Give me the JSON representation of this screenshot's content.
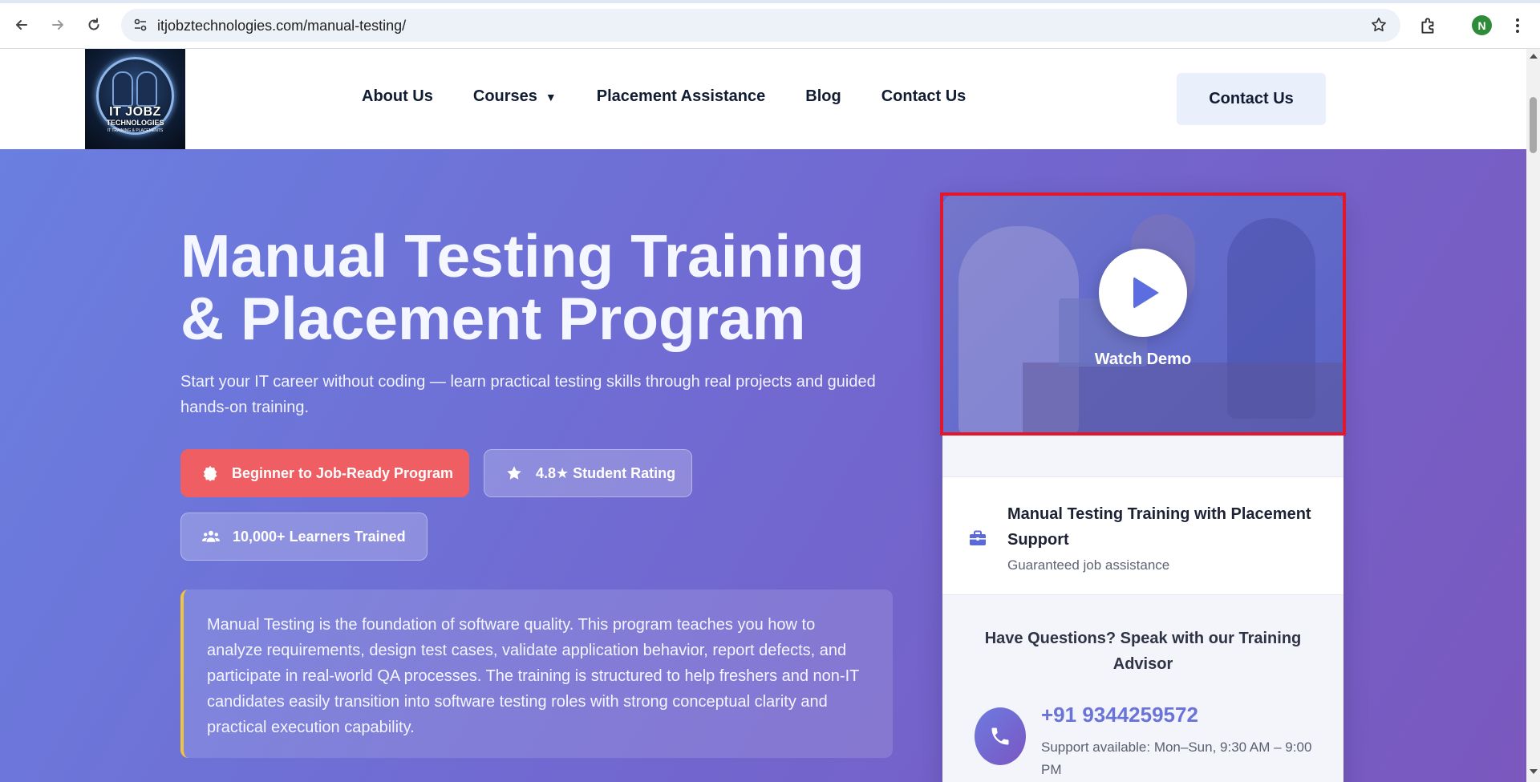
{
  "browser": {
    "url": "itjobztechnologies.com/manual-testing/",
    "profile_initial": "N"
  },
  "logo": {
    "line1": "IT JOBZ",
    "line2": "TECHNOLOGIES",
    "line3": "IT TRAINING & PLACEMENTS"
  },
  "nav": {
    "items": [
      {
        "label": "About Us"
      },
      {
        "label": "Courses"
      },
      {
        "label": "Placement Assistance"
      },
      {
        "label": "Blog"
      },
      {
        "label": "Contact Us"
      }
    ],
    "courses_caret": "▼",
    "cta_label": "Contact Us"
  },
  "hero": {
    "title": "Manual Testing Training & Placement Program",
    "subtitle": "Start your IT career without coding — learn practical testing skills through real projects and guided hands-on training.",
    "badges": {
      "program": "Beginner to Job-Ready Program",
      "rating": "4.8★ Student Rating",
      "learners": "10,000+ Learners Trained"
    },
    "intro": "Manual Testing is the foundation of software quality. This program teaches you how to analyze requirements, design test cases, validate application behavior, report defects, and participate in real-world QA processes. The training is structured to help freshers and non-IT candidates easily transition into software testing roles with strong conceptual clarity and practical execution capability."
  },
  "card": {
    "video_label": "Watch Demo",
    "feature_title": "Manual Testing Training with Placement Support",
    "feature_subtitle": "Guaranteed job assistance",
    "questions_title": "Have Questions? Speak with our Training Advisor",
    "phone": "+91 9344259572",
    "support_hours": "Support available: Mon–Sun, 9:30 AM – 9:00 PM"
  },
  "colors": {
    "hero_gradient_start": "#6a7fe0",
    "hero_gradient_end": "#7a58be",
    "badge_red": "#ee5e62",
    "accent_yellow": "#f0c443",
    "highlight_red": "#e3172b",
    "phone_color": "#6a74d8"
  },
  "icons": [
    "back-icon",
    "forward-icon",
    "reload-icon",
    "site-settings-icon",
    "bookmark-star-icon",
    "extensions-icon",
    "menu-kebab-icon",
    "badge-icon",
    "star-icon",
    "users-icon",
    "briefcase-icon",
    "play-icon",
    "phone-icon"
  ]
}
